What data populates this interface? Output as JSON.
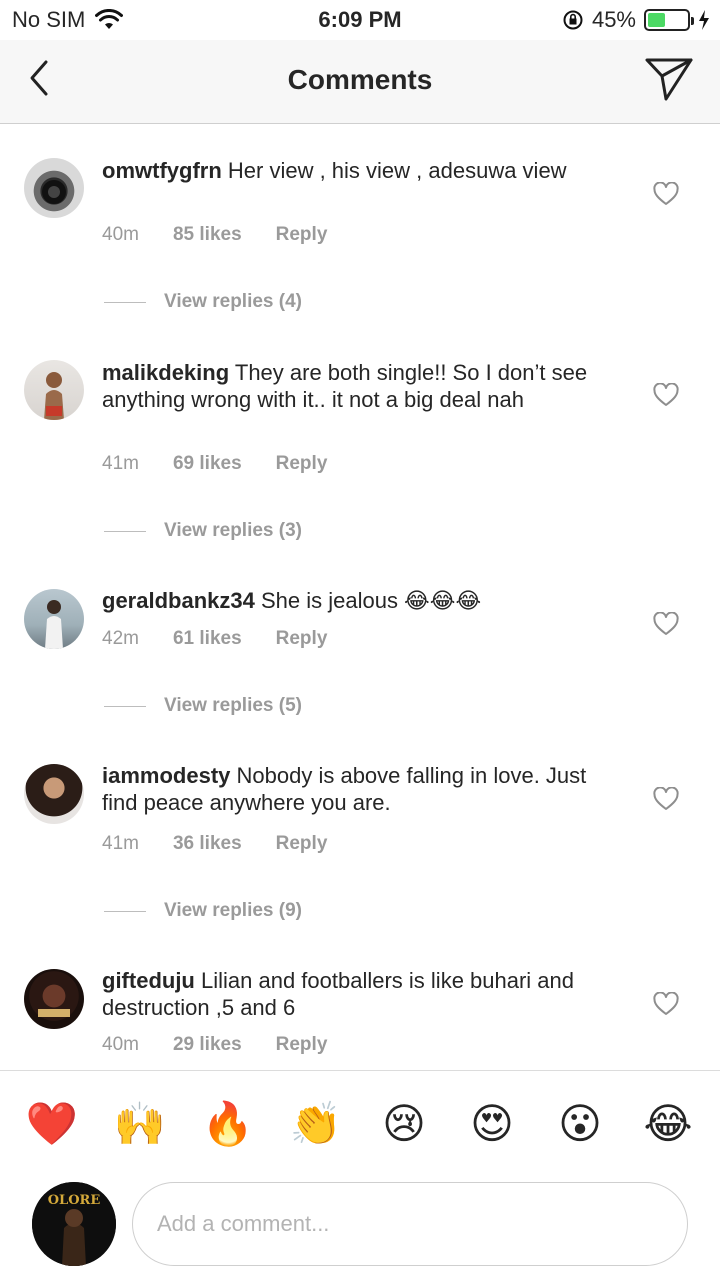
{
  "status_bar": {
    "carrier": "No SIM",
    "time": "6:09 PM",
    "battery_percent": "45%",
    "battery_level": 0.45
  },
  "nav": {
    "title": "Comments",
    "back_icon": "chevron-left-icon",
    "send_icon": "paper-plane-icon"
  },
  "comments": [
    {
      "username": "omwtfygfrn",
      "text": "Her view , his view , adesuwa view",
      "time": "40m",
      "likes": "85 likes",
      "reply": "Reply",
      "view_replies": "View replies (4)"
    },
    {
      "username": "malikdeking",
      "text": "They are both single!! So I don’t see anything wrong with it.. it not a big deal nah",
      "time": "41m",
      "likes": "69 likes",
      "reply": "Reply",
      "view_replies": "View replies (3)"
    },
    {
      "username": "geraldbankz34",
      "text": "She is jealous 😂😂😂",
      "time": "42m",
      "likes": "61 likes",
      "reply": "Reply",
      "view_replies": "View replies (5)"
    },
    {
      "username": "iammodesty",
      "text": "Nobody is above falling in love. Just find peace anywhere you are.",
      "time": "41m",
      "likes": "36 likes",
      "reply": "Reply",
      "view_replies": "View replies (9)"
    },
    {
      "username": "gifteduju",
      "text": "Lilian and footballers is like buhari and destruction ,5 and 6",
      "time": "40m",
      "likes": "29 likes",
      "reply": "Reply"
    }
  ],
  "emoji_bar": [
    "❤️",
    "🙌",
    "🔥",
    "👏",
    "😢",
    "😍",
    "😮",
    "😂"
  ],
  "composer": {
    "placeholder": "Add a comment...",
    "avatar_text": "OLORE"
  },
  "colors": {
    "meta_gray": "#9a9a9a",
    "nav_bg": "#f7f7f7",
    "battery_green": "#4cd964"
  }
}
